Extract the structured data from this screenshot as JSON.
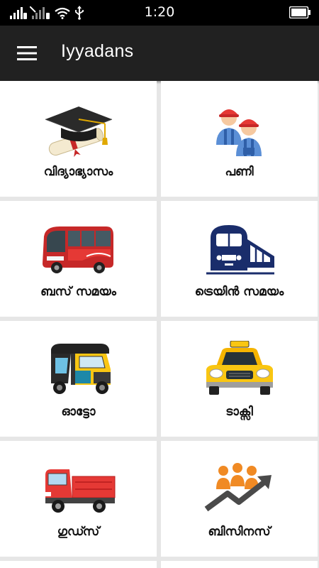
{
  "status_bar": {
    "time": "1:20"
  },
  "app_bar": {
    "title": "Iyyadans",
    "menu_icon": "hamburger-menu-icon"
  },
  "tiles": [
    {
      "label": "വിദ്യാഭ്യാസം",
      "icon": "graduation-cap-icon"
    },
    {
      "label": "പണി",
      "icon": "workers-icon"
    },
    {
      "label": "ബസ് സമയം",
      "icon": "bus-icon"
    },
    {
      "label": "ട്രെയിൻ സമയം",
      "icon": "train-icon"
    },
    {
      "label": "ഓട്ടോ",
      "icon": "auto-rickshaw-icon"
    },
    {
      "label": "ടാക്സി",
      "icon": "taxi-icon"
    },
    {
      "label": "ഗുഡ്സ്",
      "icon": "goods-truck-icon"
    },
    {
      "label": "ബിസിനസ്",
      "icon": "business-growth-icon"
    }
  ],
  "colors": {
    "app_bar": "#212121",
    "status_bar": "#000000",
    "grid_background": "#e6e6e6",
    "tile": "#ffffff"
  }
}
